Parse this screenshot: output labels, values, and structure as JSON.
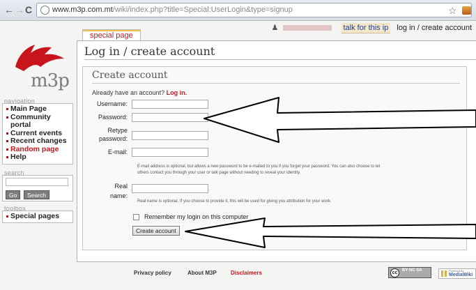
{
  "browser": {
    "back_icon": "arrow-left-icon",
    "forward_icon": "arrow-right-icon",
    "reload_icon": "reload-icon",
    "url_host": "www.m3p.com.mt",
    "url_path": "/wiki/index.php?title=Special:UserLogin&type=signup"
  },
  "personal_bar": {
    "talk_link": "talk for this ip",
    "login_link": "log in / create account"
  },
  "logo": {
    "text": "m3p"
  },
  "sidebar": {
    "navigation_heading": "navigation",
    "nav_items": [
      {
        "label": "Main Page"
      },
      {
        "label": "Community"
      },
      {
        "label": "portal"
      },
      {
        "label": "Current events"
      },
      {
        "label": "Recent changes"
      },
      {
        "label": "Random page"
      },
      {
        "label": "Help"
      }
    ],
    "search_heading": "search",
    "search_placeholder": "",
    "go_button": "Go",
    "search_button": "Search",
    "toolbox_heading": "toolbox",
    "toolbox_items": [
      {
        "label": "Special pages"
      }
    ]
  },
  "tab": {
    "label": "special page"
  },
  "content": {
    "title": "Log in / create account",
    "form_heading": "Create account",
    "already_text": "Already have an account?",
    "login_link": "Log in.",
    "username_label": "Username:",
    "password_label": "Password:",
    "retype_label_1": "Retype",
    "retype_label_2": "password:",
    "email_label": "E-mail:",
    "email_help_1": "E-mail address is optional, but allows a new password to be e-mailed to you if you forget your password. You can also choose to let",
    "email_help_2": "others contact you through your user or talk page without needing to reveal your identity.",
    "realname_label_1": "Real",
    "realname_label_2": "name:",
    "realname_help": "Real name is optional. If you choose to provide it, this will be used for giving you attribution for your work.",
    "remember_label": "Remember my login on this computer",
    "create_button": "Create account",
    "fields": {
      "username": "",
      "password": "",
      "retype": "",
      "email": "",
      "realname": ""
    }
  },
  "footer": {
    "privacy": "Privacy policy",
    "about": "About M3P",
    "disclaimers": "Disclaimers",
    "cc_text": "BY  NC  SA",
    "mw_powered": "Powered By",
    "mw_name": "MediaWiki"
  },
  "colors": {
    "link_red": "#c4161c",
    "arrow": "#000000"
  }
}
